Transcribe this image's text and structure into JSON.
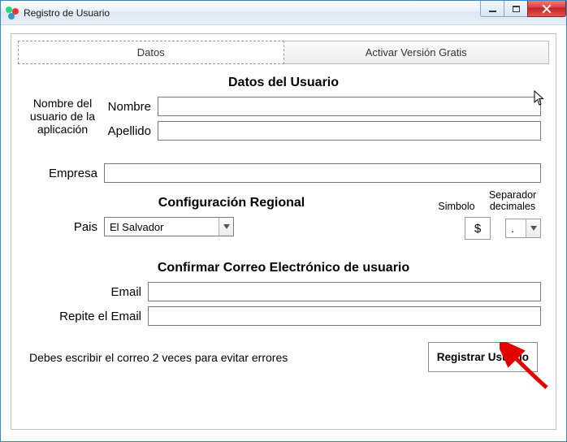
{
  "window": {
    "title": "Registro de Usuario"
  },
  "tabs": {
    "datos": "Datos",
    "activar": "Activar Versión Gratis"
  },
  "sections": {
    "datos_usuario": "Datos del Usuario",
    "config_regional": "Configuración Regional",
    "confirmar_email": "Confirmar Correo Electrónico de usuario"
  },
  "labels": {
    "side_note": "Nombre del usuario de la aplicación",
    "nombre": "Nombre",
    "apellido": "Apellido",
    "empresa": "Empresa",
    "pais": "Pais",
    "simbolo": "Simbolo",
    "separador": "Separador decimales",
    "email": "Email",
    "email2": "Repite el Email"
  },
  "values": {
    "nombre": "",
    "apellido": "",
    "empresa": "",
    "pais": "El Salvador",
    "simbolo": "$",
    "separador": ".",
    "email": "",
    "email2": ""
  },
  "footer": {
    "hint": "Debes escribir el correo 2 veces para evitar errores",
    "button": "Registrar Usuario"
  }
}
